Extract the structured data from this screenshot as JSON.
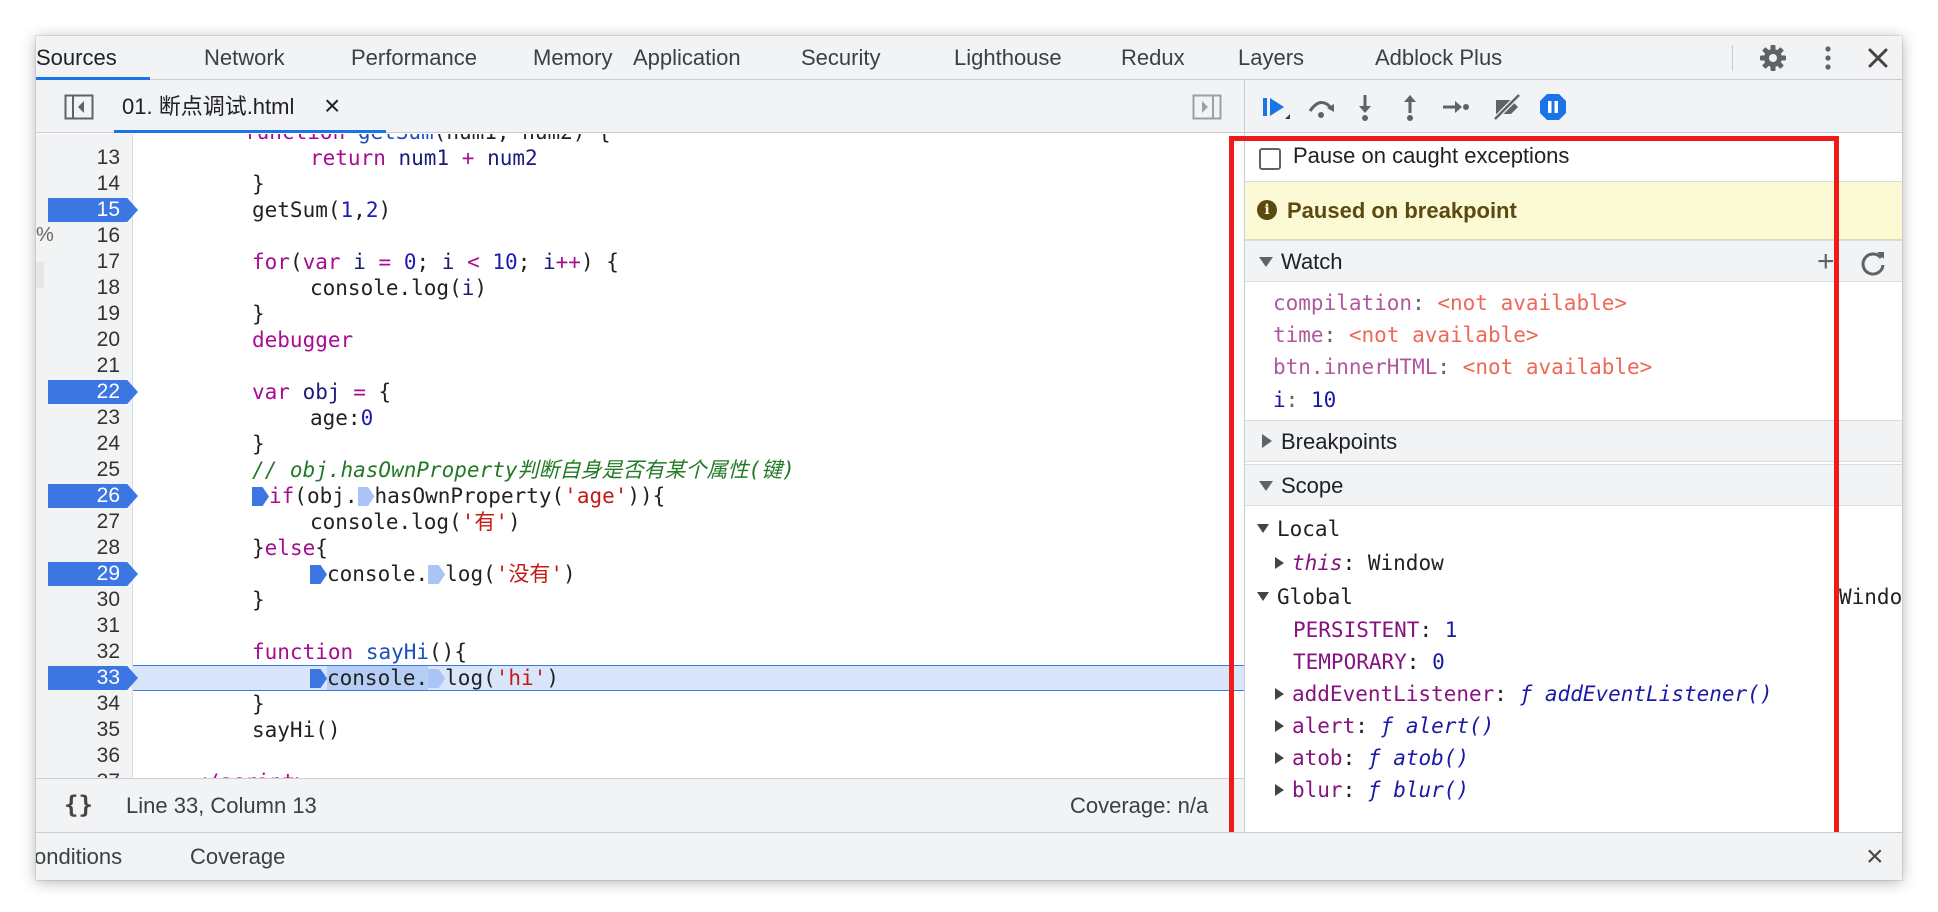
{
  "tabs": {
    "sources": "Sources",
    "network": "Network",
    "performance": "Performance",
    "memory": "Memory",
    "application": "Application",
    "security": "Security",
    "lighthouse": "Lighthouse",
    "redux": "Redux",
    "layers": "Layers",
    "adblock": "Adblock Plus"
  },
  "top_icons": {
    "settings": "gear-icon",
    "more": "kebab-menu-icon",
    "close": "close-icon"
  },
  "editor": {
    "file_tab": "01. 断点调试.html",
    "close_glyph": "×",
    "status_line": "Line 33, Column 13",
    "coverage": "Coverage: n/a",
    "braces": "{}",
    "edge_pct": "%",
    "line_numbers": [
      "13",
      "14",
      "15",
      "16",
      "17",
      "18",
      "19",
      "20",
      "21",
      "22",
      "23",
      "24",
      "25",
      "26",
      "27",
      "28",
      "29",
      "30",
      "31",
      "32",
      "33",
      "34",
      "35",
      "36",
      "37"
    ],
    "breakpoint_lines": [
      "15",
      "22",
      "26",
      "29",
      "33"
    ],
    "current_line": "33"
  },
  "debugger": {
    "toolbar_icons": [
      "resume-icon",
      "step-over-icon",
      "step-into-icon",
      "step-out-icon",
      "step-icon",
      "deactivate-breakpoints-icon",
      "pause-on-exceptions-icon"
    ],
    "pause_on_caught": "Pause on caught exceptions",
    "paused_banner": "Paused on breakpoint",
    "watch_title": "Watch",
    "watch_add": "+",
    "watch": [
      {
        "name": "compilation",
        "value": "<not available>"
      },
      {
        "name": "time",
        "value": "<not available>"
      },
      {
        "name": "btn.innerHTML",
        "value": "<not available>"
      },
      {
        "name": "i",
        "value": "10"
      }
    ],
    "breakpoints_title": "Breakpoints",
    "scope_title": "Scope",
    "scope": {
      "local_label": "Local",
      "this_key": "this",
      "this_value": "Window",
      "global_label": "Global",
      "global_value": "Window",
      "persistent_key": "PERSISTENT",
      "persistent_value": "1",
      "temporary_key": "TEMPORARY",
      "temporary_value": "0",
      "props": [
        {
          "key": "addEventListener",
          "value": "addEventListener()"
        },
        {
          "key": "alert",
          "value": "alert()"
        },
        {
          "key": "atob",
          "value": "atob()"
        },
        {
          "key": "blur",
          "value": "blur()"
        }
      ],
      "fn_glyph": "ƒ"
    }
  },
  "drawer": {
    "conditions": "onditions",
    "coverage": "Coverage",
    "close_glyph": "×"
  },
  "colors": {
    "accent": "#1a73e8",
    "breakpoint": "#3b76e3",
    "highlight_frame": "#ee1b1b",
    "paused_banner_bg": "#fcf9d5"
  }
}
